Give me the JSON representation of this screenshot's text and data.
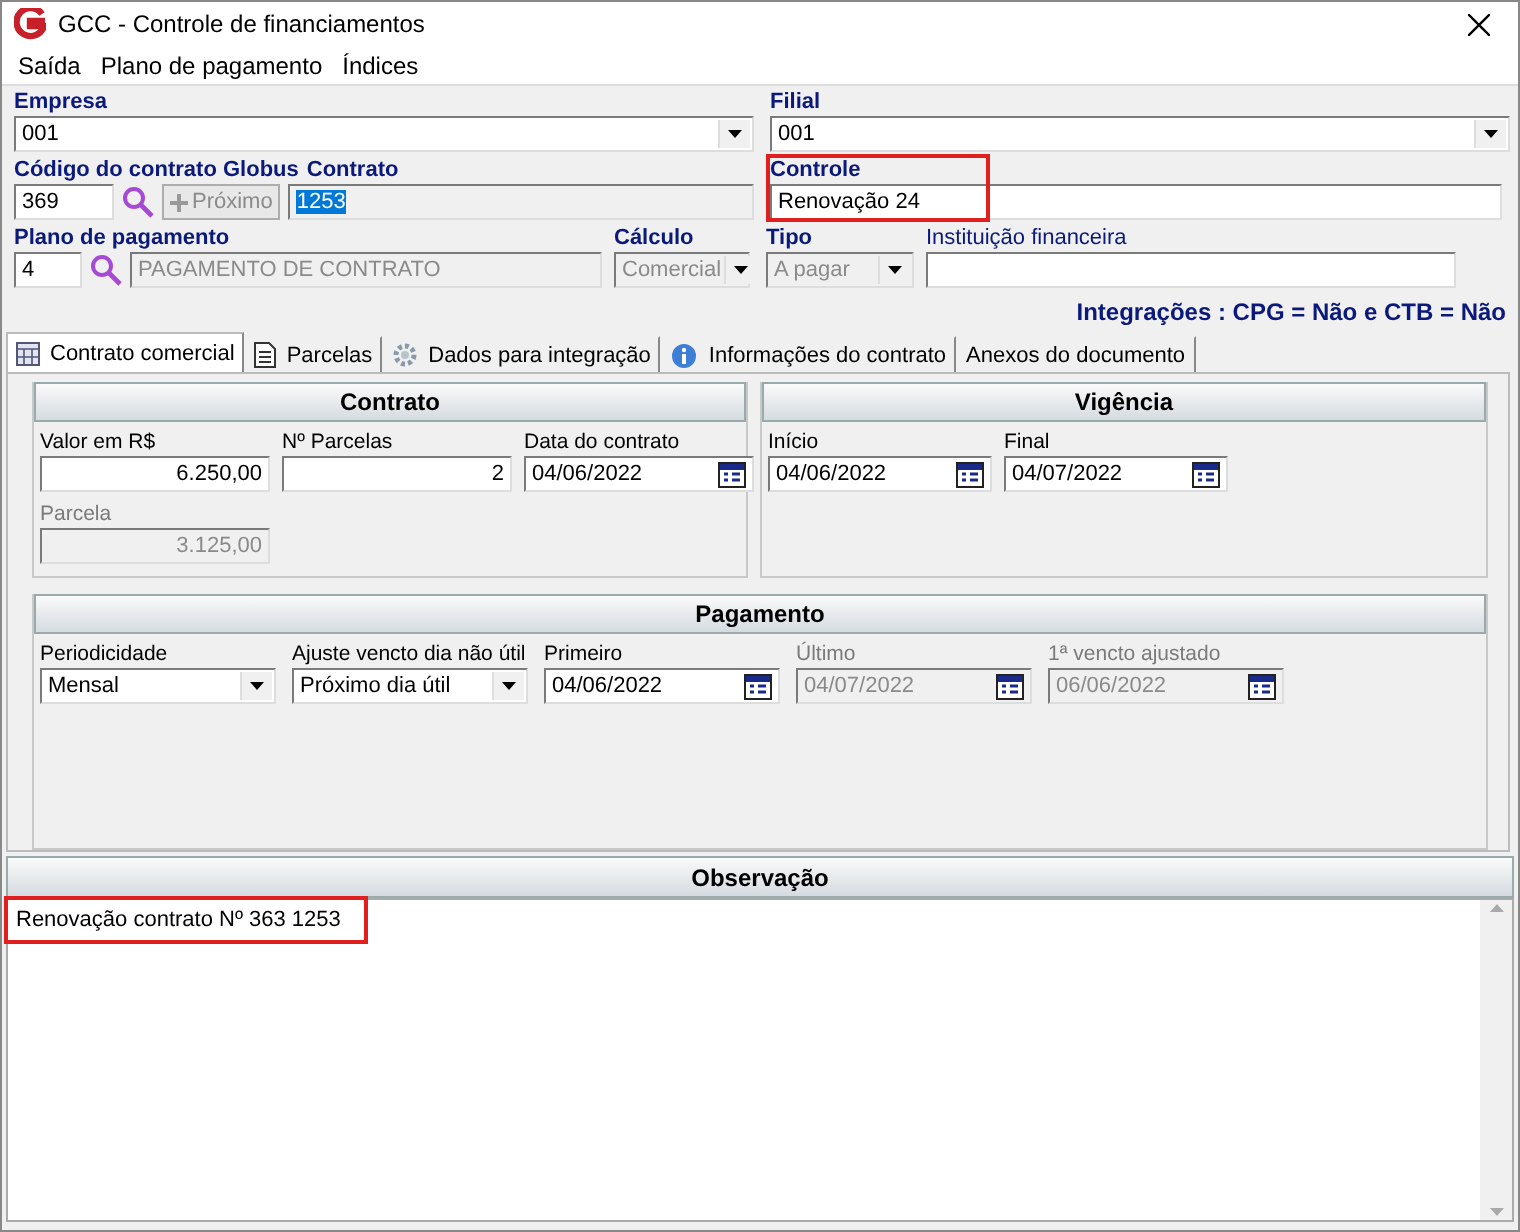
{
  "window": {
    "title": "GCC - Controle de financiamentos"
  },
  "menu": [
    {
      "label": "Saída"
    },
    {
      "label": "Plano de pagamento"
    },
    {
      "label": "Índices"
    }
  ],
  "header": {
    "empresa": {
      "label": "Empresa",
      "value": "001"
    },
    "filial": {
      "label": "Filial",
      "value": "001"
    },
    "codigo": {
      "label": "Código do contrato Globus",
      "value": "369"
    },
    "proximo": {
      "label": "Próximo",
      "disabled": true
    },
    "contrato": {
      "label": "Contrato",
      "value": "1253",
      "selected": true
    },
    "controle": {
      "label": "Controle",
      "value": "Renovação 24",
      "highlighted": true
    },
    "plano": {
      "label": "Plano de pagamento",
      "code": "4",
      "name": "PAGAMENTO DE CONTRATO"
    },
    "calculo": {
      "label": "Cálculo",
      "value": "Comercial",
      "disabled": true
    },
    "tipo": {
      "label": "Tipo",
      "value": "A pagar",
      "disabled": true
    },
    "instituicao": {
      "label": "Instituição financeira"
    },
    "integracoes": "Integrações : CPG = Não e CTB = Não"
  },
  "tabs": [
    {
      "label": "Contrato comercial",
      "selected": true
    },
    {
      "label": "Parcelas",
      "selected": false
    },
    {
      "label": "Dados para integração",
      "selected": false
    },
    {
      "label": "Informações do contrato",
      "selected": false
    },
    {
      "label": "Anexos do documento",
      "selected": false
    }
  ],
  "contrato_group": {
    "title": "Contrato",
    "fields": [
      {
        "kind": "number",
        "label": "Valor em R$",
        "value": "6.250,00",
        "disabled": false
      },
      {
        "kind": "number",
        "label": "Nº Parcelas",
        "value": "2",
        "disabled": false
      },
      {
        "kind": "date",
        "label": "Data do contrato",
        "value": "04/06/2022",
        "disabled": false
      },
      {
        "kind": "number",
        "label": "Parcela",
        "value": "3.125,00",
        "disabled": true
      }
    ]
  },
  "vigencia_group": {
    "title": "Vigência",
    "fields": [
      {
        "kind": "date",
        "label": "Início",
        "value": "04/06/2022",
        "disabled": false
      },
      {
        "kind": "date",
        "label": "Final",
        "value": "04/07/2022",
        "disabled": false
      }
    ]
  },
  "pagamento_group": {
    "title": "Pagamento",
    "fields": [
      {
        "kind": "combo",
        "label": "Periodicidade",
        "value": "Mensal",
        "disabled": false
      },
      {
        "kind": "combo",
        "label": "Ajuste vencto dia não útil",
        "value": "Próximo dia útil",
        "disabled": false
      },
      {
        "kind": "date",
        "label": "Primeiro",
        "value": "04/06/2022",
        "disabled": false
      },
      {
        "kind": "date",
        "label": "Último",
        "value": "04/07/2022",
        "disabled": true
      },
      {
        "kind": "date",
        "label": "1ª vencto ajustado",
        "value": "06/06/2022",
        "disabled": true
      }
    ]
  },
  "observacao": {
    "title": "Observação",
    "value": "Renovação contrato Nº 363 1253",
    "highlighted": true
  }
}
